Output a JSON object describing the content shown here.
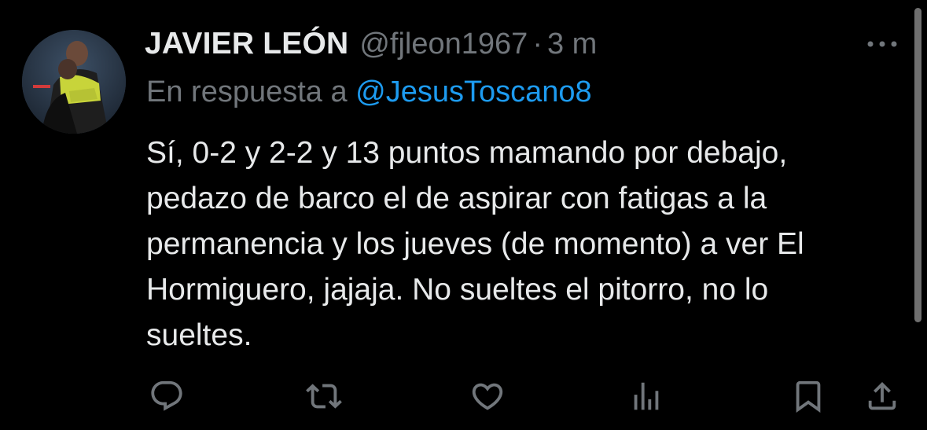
{
  "tweet": {
    "display_name": "JAVIER LEÓN",
    "handle": "@fjleon1967",
    "separator": "·",
    "time": "3 m",
    "reply_prefix": "En respuesta a",
    "reply_mention": "@JesusToscano8",
    "body_lines": [
      "Sí, 0-2 y 2-2 y 13 puntos mamando por debajo,",
      "pedazo de barco el de aspirar con fatigas a la",
      "permanencia y los jueves (de momento) a ver El",
      "Hormiguero, jajaja. No sueltes el pitorro, no lo",
      "sueltes."
    ]
  },
  "icons": {
    "more": "more-horizontal-icon",
    "reply": "reply-icon",
    "retweet": "retweet-icon",
    "like": "heart-icon",
    "views": "views-icon",
    "bookmark": "bookmark-icon",
    "share": "share-icon"
  },
  "colors": {
    "background": "#000000",
    "text_primary": "#e7e9ea",
    "text_secondary": "#71767b",
    "accent": "#1d9bf0"
  }
}
